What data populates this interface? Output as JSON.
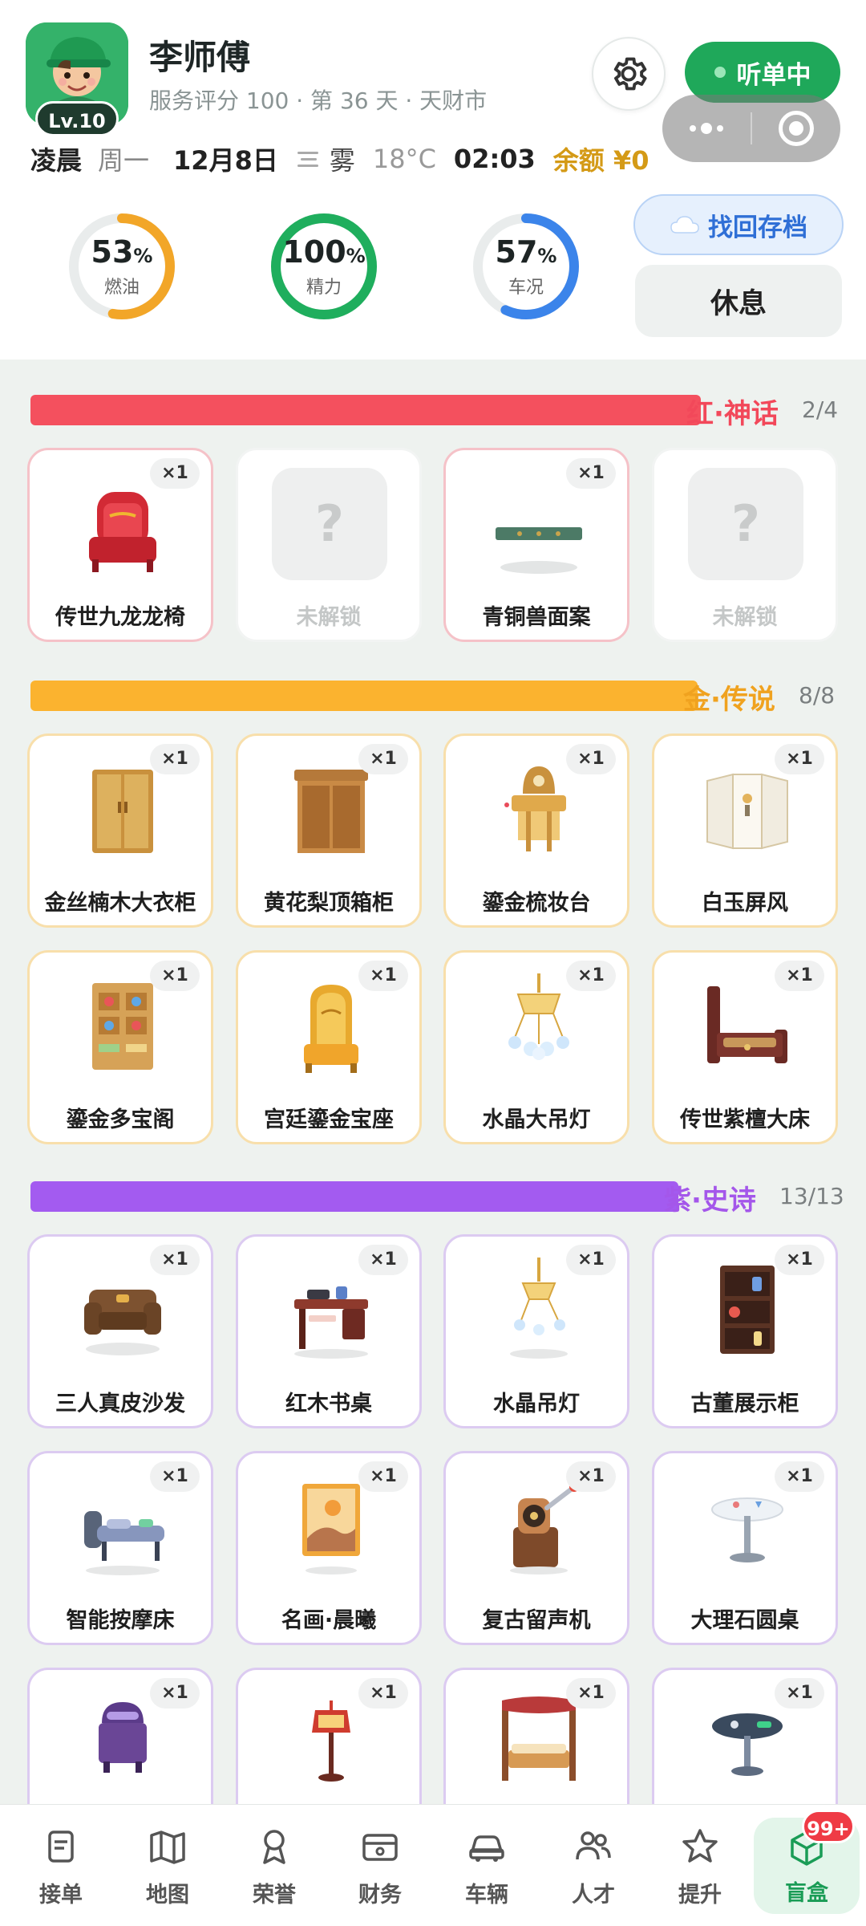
{
  "profile": {
    "name": "李师傅",
    "meta": "服务评分 100 · 第 36 天 · 天财市",
    "level": "Lv.10"
  },
  "status": {
    "label": "听单中",
    "color": "#1fa85a"
  },
  "info": {
    "time_of_day": "凌晨",
    "weekday": "周一",
    "date": "12月8日",
    "weather": "雾",
    "temperature": "18°C",
    "clock": "02:03",
    "balance": "余额 ¥0"
  },
  "gauges": [
    {
      "value": "53",
      "unit": "%",
      "label": "燃油",
      "percent": 53,
      "color": "#f2a628"
    },
    {
      "value": "100",
      "unit": "%",
      "label": "精力",
      "percent": 100,
      "color": "#1fae5d"
    },
    {
      "value": "57",
      "unit": "%",
      "label": "车况",
      "percent": 57,
      "color": "#3b84ea"
    }
  ],
  "actions": {
    "recover_label": "找回存档",
    "rest_label": "休息"
  },
  "sections": [
    {
      "title": "红·神话",
      "count": "2/4",
      "color": "#f2485a",
      "bar_color": "#f4505e",
      "items": [
        {
          "name": "传世九龙龙椅",
          "qty": "×1",
          "icon": "dragon-throne-icon",
          "locked": false
        },
        {
          "name": "未解锁",
          "qty": "",
          "icon": "question-mark-icon",
          "locked": true
        },
        {
          "name": "青铜兽面案",
          "qty": "×1",
          "icon": "bronze-table-icon",
          "locked": false
        },
        {
          "name": "未解锁",
          "qty": "",
          "icon": "question-mark-icon",
          "locked": true
        }
      ]
    },
    {
      "title": "金·传说",
      "count": "8/8",
      "color": "#f0a21f",
      "bar_color": "#fbb32f",
      "items": [
        {
          "name": "金丝楠木大衣柜",
          "qty": "×1",
          "icon": "wardrobe-icon",
          "locked": false
        },
        {
          "name": "黄花梨顶箱柜",
          "qty": "×1",
          "icon": "cabinet-icon",
          "locked": false
        },
        {
          "name": "鎏金梳妆台",
          "qty": "×1",
          "icon": "dresser-icon",
          "locked": false
        },
        {
          "name": "白玉屏风",
          "qty": "×1",
          "icon": "folding-screen-icon",
          "locked": false
        },
        {
          "name": "鎏金多宝阁",
          "qty": "×1",
          "icon": "curio-shelf-icon",
          "locked": false
        },
        {
          "name": "宫廷鎏金宝座",
          "qty": "×1",
          "icon": "golden-throne-icon",
          "locked": false
        },
        {
          "name": "水晶大吊灯",
          "qty": "×1",
          "icon": "chandelier-icon",
          "locked": false
        },
        {
          "name": "传世紫檀大床",
          "qty": "×1",
          "icon": "bed-icon",
          "locked": false
        }
      ]
    },
    {
      "title": "紫·史诗",
      "count": "13/13",
      "color": "#a457ea",
      "bar_color": "#a35bf0",
      "items": [
        {
          "name": "三人真皮沙发",
          "qty": "×1",
          "icon": "sofa-icon",
          "locked": false
        },
        {
          "name": "红木书桌",
          "qty": "×1",
          "icon": "desk-icon",
          "locked": false
        },
        {
          "name": "水晶吊灯",
          "qty": "×1",
          "icon": "crystal-lamp-icon",
          "locked": false
        },
        {
          "name": "古董展示柜",
          "qty": "×1",
          "icon": "display-cabinet-icon",
          "locked": false
        },
        {
          "name": "智能按摩床",
          "qty": "×1",
          "icon": "massage-bed-icon",
          "locked": false
        },
        {
          "name": "名画·晨曦",
          "qty": "×1",
          "icon": "painting-icon",
          "locked": false
        },
        {
          "name": "复古留声机",
          "qty": "×1",
          "icon": "gramophone-icon",
          "locked": false
        },
        {
          "name": "大理石圆桌",
          "qty": "×1",
          "icon": "round-table-icon",
          "locked": false
        },
        {
          "name": "",
          "qty": "×1",
          "icon": "trash-bin-icon",
          "locked": false
        },
        {
          "name": "",
          "qty": "×1",
          "icon": "sign-stand-icon",
          "locked": false
        },
        {
          "name": "",
          "qty": "×1",
          "icon": "canopy-bed-icon",
          "locked": false
        },
        {
          "name": "",
          "qty": "×1",
          "icon": "dj-table-icon",
          "locked": false
        }
      ]
    }
  ],
  "tabs": [
    {
      "label": "接单",
      "icon": "clipboard-icon",
      "active": false
    },
    {
      "label": "地图",
      "icon": "map-icon",
      "active": false
    },
    {
      "label": "荣誉",
      "icon": "medal-icon",
      "active": false
    },
    {
      "label": "财务",
      "icon": "wallet-icon",
      "active": false
    },
    {
      "label": "车辆",
      "icon": "car-icon",
      "active": false
    },
    {
      "label": "人才",
      "icon": "people-icon",
      "active": false
    },
    {
      "label": "提升",
      "icon": "star-icon",
      "active": false
    },
    {
      "label": "盲盒",
      "icon": "box-icon",
      "active": true,
      "badge": "99+"
    }
  ]
}
